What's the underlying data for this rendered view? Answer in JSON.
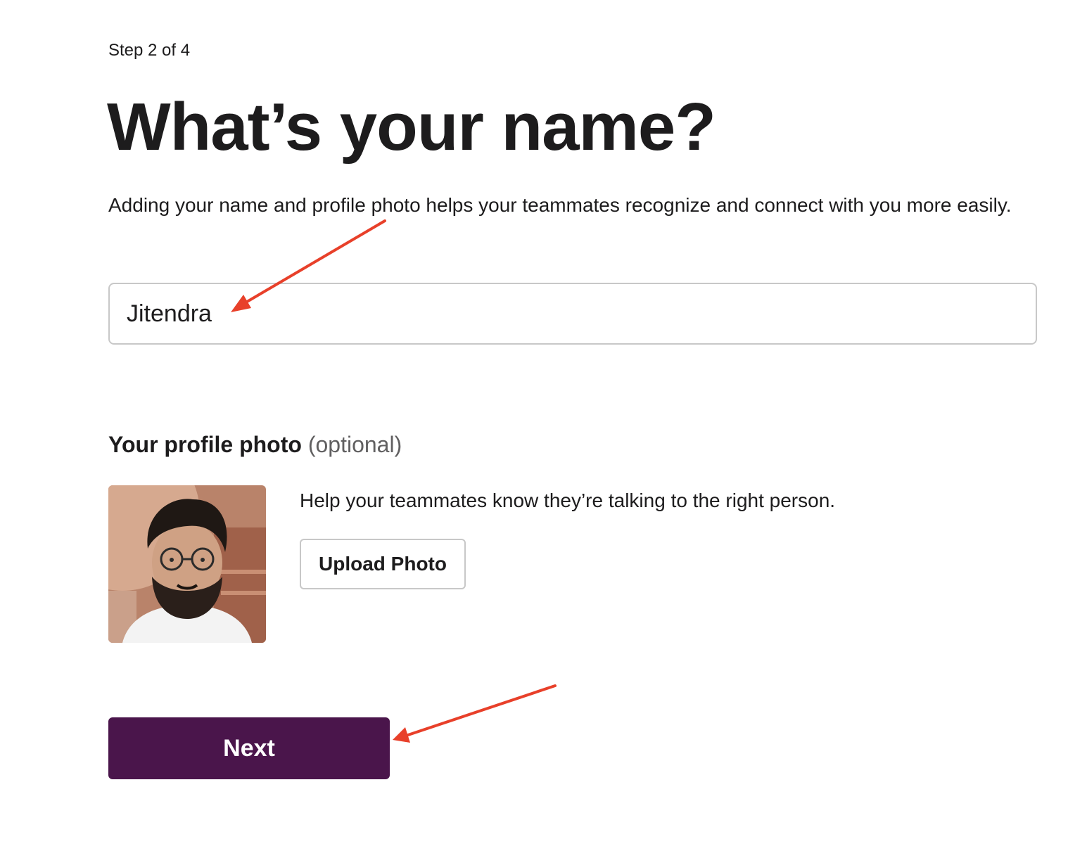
{
  "onboarding": {
    "step_text": "Step 2 of 4",
    "title": "What’s your name?",
    "description": "Adding your name and profile photo helps your teammates recognize and connect with you more easily."
  },
  "name_field": {
    "value": "Jitendra"
  },
  "profile_photo": {
    "heading": "Your profile photo",
    "optional_label": "(optional)",
    "help_text": "Help your teammates know they’re talking to the right person.",
    "upload_label": "Upload Photo"
  },
  "actions": {
    "next_label": "Next"
  },
  "colors": {
    "primary_button": "#4a154b",
    "annotation_arrow": "#e8402a"
  }
}
